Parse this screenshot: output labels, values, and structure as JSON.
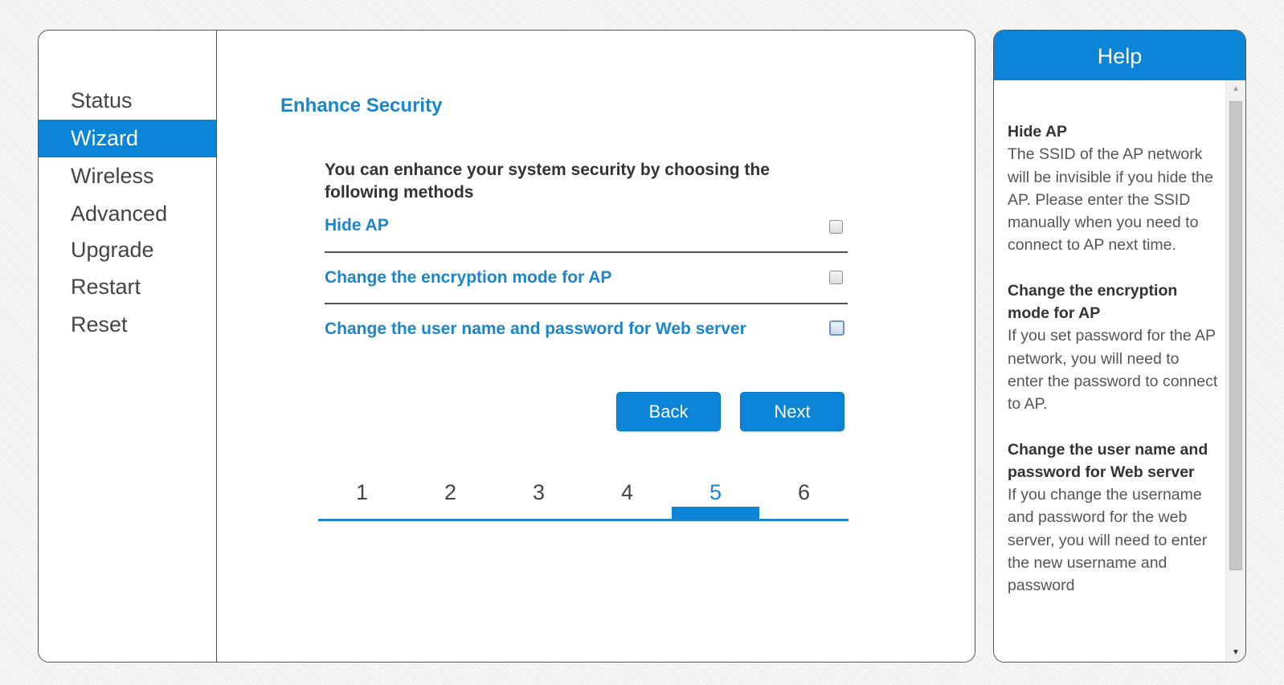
{
  "sidebar": {
    "items": [
      {
        "label": "Status",
        "active": false
      },
      {
        "label": "Wizard",
        "active": true
      },
      {
        "label": "Wireless",
        "active": false
      },
      {
        "label": "Advanced",
        "active": false
      },
      {
        "label": "Upgrade",
        "active": false
      },
      {
        "label": "Restart",
        "active": false
      },
      {
        "label": "Reset",
        "active": false
      }
    ]
  },
  "main": {
    "title": "Enhance Security",
    "intro": "You can enhance your system security by choosing the following methods",
    "options": [
      {
        "label": "Hide AP",
        "checked": false
      },
      {
        "label": "Change the encryption mode for AP",
        "checked": false
      },
      {
        "label": "Change the user name and password for Web server",
        "checked": false
      }
    ],
    "back_label": "Back",
    "next_label": "Next",
    "steps": [
      "1",
      "2",
      "3",
      "4",
      "5",
      "6"
    ],
    "current_step": "5"
  },
  "help": {
    "title": "Help",
    "sections": [
      {
        "heading": "Hide AP",
        "text": "The SSID of the AP network will be invisible if you hide the AP. Please enter the SSID manually when you need to connect to AP next time."
      },
      {
        "heading": "Change the encryption mode for AP",
        "text": "If you set password for the AP network, you will need to enter the password to connect to AP."
      },
      {
        "heading": "Change the user name and password for Web server",
        "text": "If you change the username and password for the web server, you will need to enter the new username and password"
      }
    ]
  },
  "colors": {
    "accent": "#0a84d6",
    "link": "#1a86d0"
  },
  "icons": {
    "scroll_up": "triangle-up",
    "scroll_down": "triangle-down"
  }
}
